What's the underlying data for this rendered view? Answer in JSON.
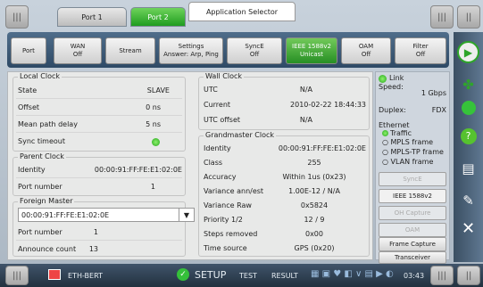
{
  "ports": {
    "port1": "Port 1",
    "port2": "Port 2",
    "app_selector": "Application Selector"
  },
  "toolbar": [
    {
      "key": "port",
      "label": "Port"
    },
    {
      "key": "wan",
      "label": "WAN\nOff"
    },
    {
      "key": "stream",
      "label": "Stream"
    },
    {
      "key": "settings",
      "label": "Settings\nAnswer: Arp, Ping"
    },
    {
      "key": "synce",
      "label": "SyncE\nOff"
    },
    {
      "key": "ieee",
      "label": "IEEE 1588v2\nUnicast"
    },
    {
      "key": "oam",
      "label": "OAM\nOff"
    },
    {
      "key": "filter",
      "label": "Filter\nOff"
    }
  ],
  "local_clock": {
    "title": "Local Clock",
    "state_l": "State",
    "state_v": "SLAVE",
    "offset_l": "Offset",
    "offset_v": "0 ns",
    "mpd_l": "Mean path delay",
    "mpd_v": "5 ns",
    "sync_l": "Sync timeout"
  },
  "parent_clock": {
    "title": "Parent Clock",
    "id_l": "Identity",
    "id_v": "00:00:91:FF:FE:E1:02:0E",
    "pn_l": "Port number",
    "pn_v": "1"
  },
  "foreign_master": {
    "title": "Foreign Master",
    "selected": "00:00:91:FF:FE:E1:02:0E",
    "pn_l": "Port number",
    "pn_v": "1",
    "ac_l": "Announce count",
    "ac_v": "13"
  },
  "wall_clock": {
    "title": "Wall Clock",
    "utc_l": "UTC",
    "utc_v": "N/A",
    "cur_l": "Current",
    "cur_v": "2010-02-22 18:44:33",
    "off_l": "UTC offset",
    "off_v": "N/A"
  },
  "grandmaster": {
    "title": "Grandmaster Clock",
    "rows": [
      {
        "l": "Identity",
        "v": "00:00:91:FF:FE:E1:02:0E"
      },
      {
        "l": "Class",
        "v": "255"
      },
      {
        "l": "Accuracy",
        "v": "Within 1us (0x23)"
      },
      {
        "l": "Variance ann/est",
        "v": "1.00E-12  /  N/A"
      },
      {
        "l": "Variance Raw",
        "v": "0x5824"
      },
      {
        "l": "Priority 1/2",
        "v": "12  /  9"
      },
      {
        "l": "Steps removed",
        "v": "0x00"
      },
      {
        "l": "Time source",
        "v": "GPS (0x20)"
      }
    ]
  },
  "status": {
    "link": "Link",
    "speed_l": "Speed:",
    "speed_v": "1 Gbps",
    "duplex_l": "Duplex:",
    "duplex_v": "FDX",
    "ethernet": "Ethernet",
    "traffic": "Traffic",
    "mpls": "MPLS frame",
    "mplstp": "MPLS-TP frame",
    "vlan": "VLAN frame",
    "synce": "SyncE",
    "ieee": "IEEE 1588v2",
    "oh": "OH Capture",
    "oam": "OAM",
    "frame_capture": "Frame Capture",
    "transceiver": "Transceiver"
  },
  "bottom": {
    "app": "ETH-BERT",
    "setup": "SETUP",
    "test": "TEST",
    "result": "RESULT",
    "time": "03:43"
  }
}
